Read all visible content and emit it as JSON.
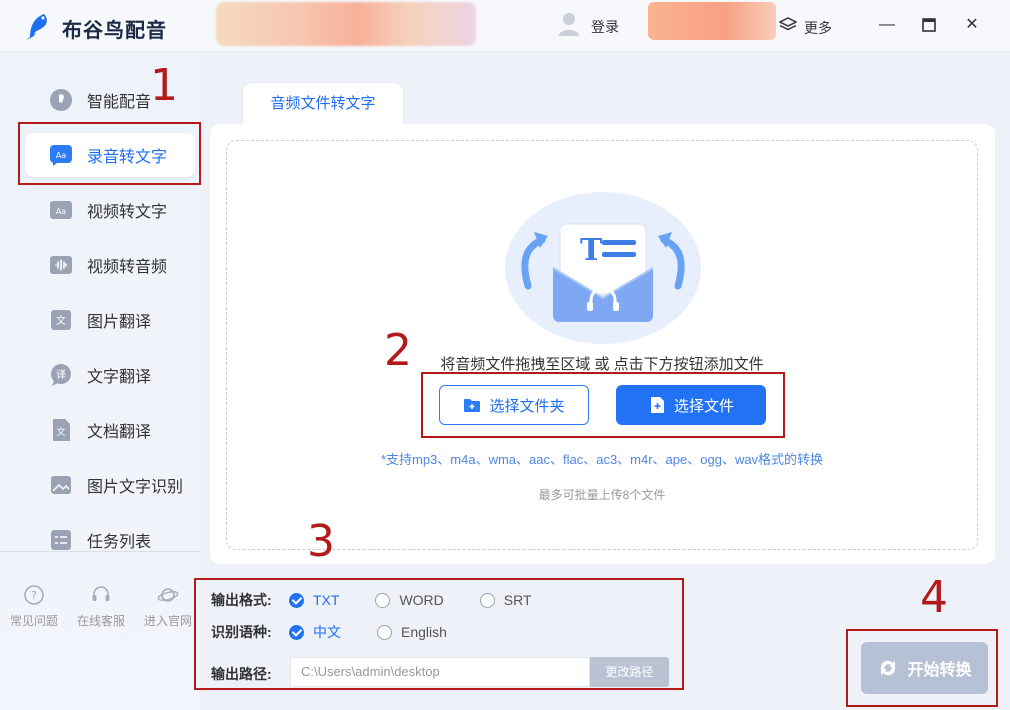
{
  "app": {
    "title": "布谷鸟配音"
  },
  "header": {
    "login_label": "登录",
    "more_label": "更多",
    "minimize": "—",
    "close": "✕"
  },
  "sidebar": {
    "items": [
      {
        "label": "智能配音"
      },
      {
        "label": "录音转文字"
      },
      {
        "label": "视频转文字"
      },
      {
        "label": "视频转音频"
      },
      {
        "label": "图片翻译"
      },
      {
        "label": "文字翻译"
      },
      {
        "label": "文档翻译"
      },
      {
        "label": "图片文字识别"
      },
      {
        "label": "任务列表"
      }
    ],
    "footer": [
      {
        "label": "常见问题"
      },
      {
        "label": "在线客服"
      },
      {
        "label": "进入官网"
      }
    ]
  },
  "main": {
    "tab_label": "音频文件转文字",
    "drop_hint": "将音频文件拖拽至区域 或 点击下方按钮添加文件",
    "select_folder_label": "选择文件夹",
    "select_file_label": "选择文件",
    "supported_formats": "*支持mp3、m4a、wma、aac、flac、ac3、m4r、ape、ogg、wav格式的转换",
    "max_files": "最多可批量上传8个文件"
  },
  "options": {
    "format_label": "输出格式:",
    "formats": [
      {
        "label": "TXT",
        "selected": true
      },
      {
        "label": "WORD",
        "selected": false
      },
      {
        "label": "SRT",
        "selected": false
      }
    ],
    "lang_label": "识别语种:",
    "languages": [
      {
        "label": "中文",
        "selected": true
      },
      {
        "label": "English",
        "selected": false
      }
    ],
    "path_label": "输出路径:",
    "path_value": "C:\\Users\\admin\\desktop",
    "change_path_label": "更改路径"
  },
  "start_label": "开始转换",
  "annotations": [
    "1",
    "2",
    "3",
    "4"
  ],
  "colors": {
    "accent": "#2272f5",
    "annotation": "#b31b1b",
    "start_disabled": "#b7c1d5"
  }
}
